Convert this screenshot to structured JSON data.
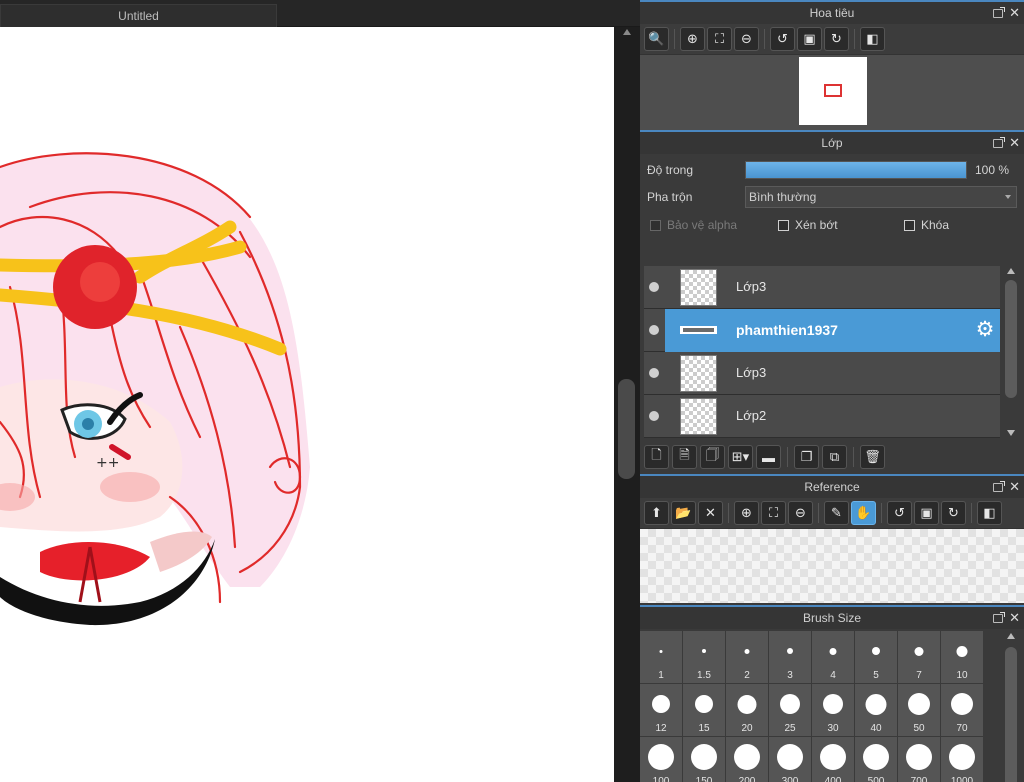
{
  "document": {
    "tab_title": "Untitled"
  },
  "navigator": {
    "title": "Hoa tiêu",
    "tools": [
      {
        "icon": "zoom-actual-icon",
        "glyph": "🔍"
      },
      {
        "icon": "zoom-in-icon",
        "glyph": "⊕"
      },
      {
        "icon": "fit-icon",
        "glyph": "⛶"
      },
      {
        "icon": "zoom-out-icon",
        "glyph": "⊖"
      },
      {
        "icon": "rotate-left-icon",
        "glyph": "↺"
      },
      {
        "icon": "reset-view-icon",
        "glyph": "▣"
      },
      {
        "icon": "rotate-right-icon",
        "glyph": "↻"
      },
      {
        "icon": "flip-icon",
        "glyph": "◧"
      }
    ]
  },
  "layers": {
    "title": "Lớp",
    "opacity_label": "Độ trong",
    "opacity": 100,
    "opacity_text": "100 %",
    "blend_label": "Pha trộn",
    "blend_value": "Bình thường",
    "protect_alpha": "Bảo vệ alpha",
    "clipping": "Xén bớt",
    "lock": "Khóa",
    "items": [
      {
        "name": "Lớp3",
        "selected": false
      },
      {
        "name": "phamthien1937",
        "selected": true
      },
      {
        "name": "Lớp3",
        "selected": false
      },
      {
        "name": "Lớp2",
        "selected": false
      }
    ],
    "tools": [
      {
        "icon": "new-layer-icon",
        "glyph": "🗋"
      },
      {
        "icon": "new-halftone-layer-icon",
        "glyph": "🗎"
      },
      {
        "icon": "new-8bit-layer-icon",
        "glyph": "🗍"
      },
      {
        "icon": "add-layer-menu-icon",
        "glyph": "⊞▾"
      },
      {
        "icon": "folder-icon",
        "glyph": "▬"
      },
      {
        "icon": "duplicate-layer-icon",
        "glyph": "❐"
      },
      {
        "icon": "merge-layer-icon",
        "glyph": "⧉"
      },
      {
        "icon": "delete-layer-icon",
        "glyph": "🗑"
      }
    ]
  },
  "reference": {
    "title": "Reference",
    "tools": [
      {
        "icon": "upload-icon",
        "glyph": "⬆"
      },
      {
        "icon": "open-folder-icon",
        "glyph": "📂"
      },
      {
        "icon": "close-icon",
        "glyph": "✕"
      },
      {
        "icon": "zoom-in-icon",
        "glyph": "⊕"
      },
      {
        "icon": "fit-icon",
        "glyph": "⛶"
      },
      {
        "icon": "zoom-out-icon",
        "glyph": "⊖"
      },
      {
        "icon": "eyedropper-icon",
        "glyph": "✎"
      },
      {
        "icon": "hand-icon",
        "glyph": "✋"
      },
      {
        "icon": "rotate-left-icon",
        "glyph": "↺"
      },
      {
        "icon": "reset-view-icon",
        "glyph": "▣"
      },
      {
        "icon": "rotate-right-icon",
        "glyph": "↻"
      },
      {
        "icon": "flip-icon",
        "glyph": "◧"
      }
    ]
  },
  "brush_size": {
    "title": "Brush Size",
    "sizes": [
      "1",
      "1.5",
      "2",
      "3",
      "4",
      "5",
      "7",
      "10",
      "12",
      "15",
      "20",
      "25",
      "30",
      "40",
      "50",
      "70",
      "100",
      "150",
      "200",
      "300",
      "400",
      "500",
      "700",
      "1000"
    ]
  },
  "colors": {
    "accent": "#4a9ad6",
    "panel": "#3a3a3a"
  }
}
